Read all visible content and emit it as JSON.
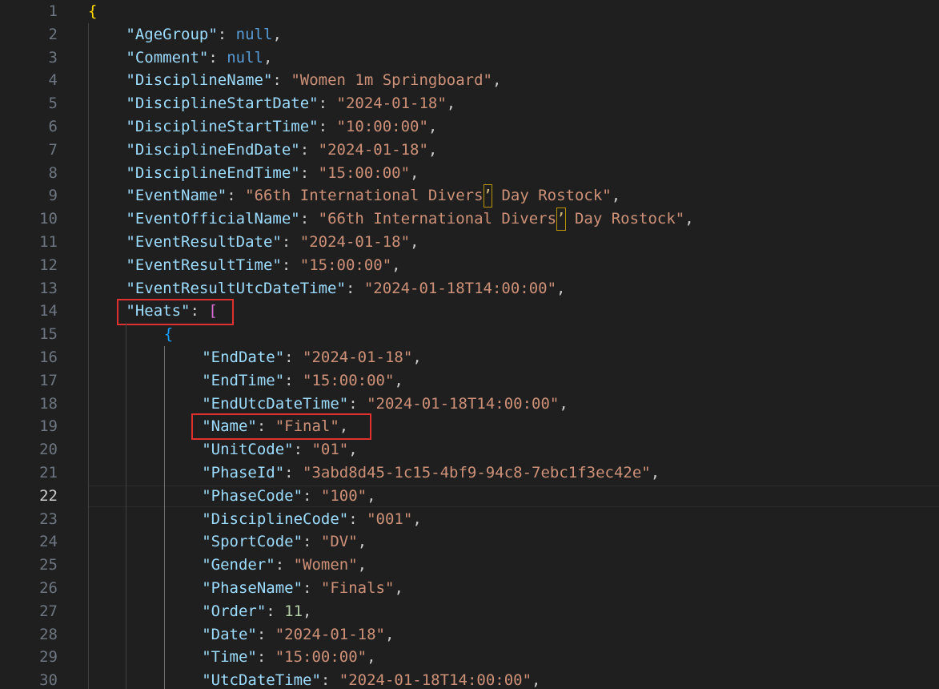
{
  "editor": {
    "current_line": 22,
    "lines": [
      {
        "n": "1",
        "indent": 0,
        "parts": [
          [
            "b1",
            "{"
          ]
        ]
      },
      {
        "n": "2",
        "indent": 1,
        "parts": [
          [
            "k",
            "\"AgeGroup\""
          ],
          [
            "p",
            ": "
          ],
          [
            "n",
            "null"
          ],
          [
            "p",
            ","
          ]
        ]
      },
      {
        "n": "3",
        "indent": 1,
        "parts": [
          [
            "k",
            "\"Comment\""
          ],
          [
            "p",
            ": "
          ],
          [
            "n",
            "null"
          ],
          [
            "p",
            ","
          ]
        ]
      },
      {
        "n": "4",
        "indent": 1,
        "parts": [
          [
            "k",
            "\"DisciplineName\""
          ],
          [
            "p",
            ": "
          ],
          [
            "s",
            "\"Women 1m Springboard\""
          ],
          [
            "p",
            ","
          ]
        ]
      },
      {
        "n": "5",
        "indent": 1,
        "parts": [
          [
            "k",
            "\"DisciplineStartDate\""
          ],
          [
            "p",
            ": "
          ],
          [
            "s",
            "\"2024-01-18\""
          ],
          [
            "p",
            ","
          ]
        ]
      },
      {
        "n": "6",
        "indent": 1,
        "parts": [
          [
            "k",
            "\"DisciplineStartTime\""
          ],
          [
            "p",
            ": "
          ],
          [
            "s",
            "\"10:00:00\""
          ],
          [
            "p",
            ","
          ]
        ]
      },
      {
        "n": "7",
        "indent": 1,
        "parts": [
          [
            "k",
            "\"DisciplineEndDate\""
          ],
          [
            "p",
            ": "
          ],
          [
            "s",
            "\"2024-01-18\""
          ],
          [
            "p",
            ","
          ]
        ]
      },
      {
        "n": "8",
        "indent": 1,
        "parts": [
          [
            "k",
            "\"DisciplineEndTime\""
          ],
          [
            "p",
            ": "
          ],
          [
            "s",
            "\"15:00:00\""
          ],
          [
            "p",
            ","
          ]
        ]
      },
      {
        "n": "9",
        "indent": 1,
        "parts": [
          [
            "k",
            "\"EventName\""
          ],
          [
            "p",
            ": "
          ],
          [
            "s",
            "\"66th International Divers"
          ],
          [
            "bm",
            "’"
          ],
          [
            "s",
            " Day Rostock\""
          ],
          [
            "p",
            ","
          ]
        ]
      },
      {
        "n": "10",
        "indent": 1,
        "parts": [
          [
            "k",
            "\"EventOfficialName\""
          ],
          [
            "p",
            ": "
          ],
          [
            "s",
            "\"66th International Divers"
          ],
          [
            "bm",
            "’"
          ],
          [
            "s",
            " Day Rostock\""
          ],
          [
            "p",
            ","
          ]
        ]
      },
      {
        "n": "11",
        "indent": 1,
        "parts": [
          [
            "k",
            "\"EventResultDate\""
          ],
          [
            "p",
            ": "
          ],
          [
            "s",
            "\"2024-01-18\""
          ],
          [
            "p",
            ","
          ]
        ]
      },
      {
        "n": "12",
        "indent": 1,
        "parts": [
          [
            "k",
            "\"EventResultTime\""
          ],
          [
            "p",
            ": "
          ],
          [
            "s",
            "\"15:00:00\""
          ],
          [
            "p",
            ","
          ]
        ]
      },
      {
        "n": "13",
        "indent": 1,
        "parts": [
          [
            "k",
            "\"EventResultUtcDateTime\""
          ],
          [
            "p",
            ": "
          ],
          [
            "s",
            "\"2024-01-18T14:00:00\""
          ],
          [
            "p",
            ","
          ]
        ]
      },
      {
        "n": "14",
        "indent": 1,
        "parts": [
          [
            "k",
            "\"Heats\""
          ],
          [
            "p",
            ": "
          ],
          [
            "b2",
            "["
          ]
        ]
      },
      {
        "n": "15",
        "indent": 2,
        "parts": [
          [
            "b3",
            "{"
          ]
        ]
      },
      {
        "n": "16",
        "indent": 3,
        "parts": [
          [
            "k",
            "\"EndDate\""
          ],
          [
            "p",
            ": "
          ],
          [
            "s",
            "\"2024-01-18\""
          ],
          [
            "p",
            ","
          ]
        ]
      },
      {
        "n": "17",
        "indent": 3,
        "parts": [
          [
            "k",
            "\"EndTime\""
          ],
          [
            "p",
            ": "
          ],
          [
            "s",
            "\"15:00:00\""
          ],
          [
            "p",
            ","
          ]
        ]
      },
      {
        "n": "18",
        "indent": 3,
        "parts": [
          [
            "k",
            "\"EndUtcDateTime\""
          ],
          [
            "p",
            ": "
          ],
          [
            "s",
            "\"2024-01-18T14:00:00\""
          ],
          [
            "p",
            ","
          ]
        ]
      },
      {
        "n": "19",
        "indent": 3,
        "parts": [
          [
            "k",
            "\"Name\""
          ],
          [
            "p",
            ": "
          ],
          [
            "s",
            "\"Final\""
          ],
          [
            "p",
            ","
          ]
        ]
      },
      {
        "n": "20",
        "indent": 3,
        "parts": [
          [
            "k",
            "\"UnitCode\""
          ],
          [
            "p",
            ": "
          ],
          [
            "s",
            "\"01\""
          ],
          [
            "p",
            ","
          ]
        ]
      },
      {
        "n": "21",
        "indent": 3,
        "parts": [
          [
            "k",
            "\"PhaseId\""
          ],
          [
            "p",
            ": "
          ],
          [
            "s",
            "\"3abd8d45-1c15-4bf9-94c8-7ebc1f3ec42e\""
          ],
          [
            "p",
            ","
          ]
        ]
      },
      {
        "n": "22",
        "indent": 3,
        "parts": [
          [
            "k",
            "\"PhaseCode\""
          ],
          [
            "p",
            ": "
          ],
          [
            "s",
            "\"100\""
          ],
          [
            "p",
            ","
          ]
        ]
      },
      {
        "n": "23",
        "indent": 3,
        "parts": [
          [
            "k",
            "\"DisciplineCode\""
          ],
          [
            "p",
            ": "
          ],
          [
            "s",
            "\"001\""
          ],
          [
            "p",
            ","
          ]
        ]
      },
      {
        "n": "24",
        "indent": 3,
        "parts": [
          [
            "k",
            "\"SportCode\""
          ],
          [
            "p",
            ": "
          ],
          [
            "s",
            "\"DV\""
          ],
          [
            "p",
            ","
          ]
        ]
      },
      {
        "n": "25",
        "indent": 3,
        "parts": [
          [
            "k",
            "\"Gender\""
          ],
          [
            "p",
            ": "
          ],
          [
            "s",
            "\"Women\""
          ],
          [
            "p",
            ","
          ]
        ]
      },
      {
        "n": "26",
        "indent": 3,
        "parts": [
          [
            "k",
            "\"PhaseName\""
          ],
          [
            "p",
            ": "
          ],
          [
            "s",
            "\"Finals\""
          ],
          [
            "p",
            ","
          ]
        ]
      },
      {
        "n": "27",
        "indent": 3,
        "parts": [
          [
            "k",
            "\"Order\""
          ],
          [
            "p",
            ": "
          ],
          [
            "num",
            "11"
          ],
          [
            "p",
            ","
          ]
        ]
      },
      {
        "n": "28",
        "indent": 3,
        "parts": [
          [
            "k",
            "\"Date\""
          ],
          [
            "p",
            ": "
          ],
          [
            "s",
            "\"2024-01-18\""
          ],
          [
            "p",
            ","
          ]
        ]
      },
      {
        "n": "29",
        "indent": 3,
        "parts": [
          [
            "k",
            "\"Time\""
          ],
          [
            "p",
            ": "
          ],
          [
            "s",
            "\"15:00:00\""
          ],
          [
            "p",
            ","
          ]
        ]
      },
      {
        "n": "30",
        "indent": 3,
        "parts": [
          [
            "k",
            "\"UtcDateTime\""
          ],
          [
            "p",
            ": "
          ],
          [
            "s",
            "\"2024-01-18T14:00:00\""
          ],
          [
            "p",
            ","
          ]
        ]
      }
    ]
  },
  "annotations": [
    {
      "label": "highlight-heats",
      "line": "14"
    },
    {
      "label": "highlight-name",
      "line": "19"
    }
  ],
  "colors": {
    "background": "#1f1f1f",
    "key": "#9cdcfe",
    "string": "#ce9178",
    "keyword": "#569cd6",
    "number": "#b5cea8",
    "highlight_box": "#e0312f"
  }
}
